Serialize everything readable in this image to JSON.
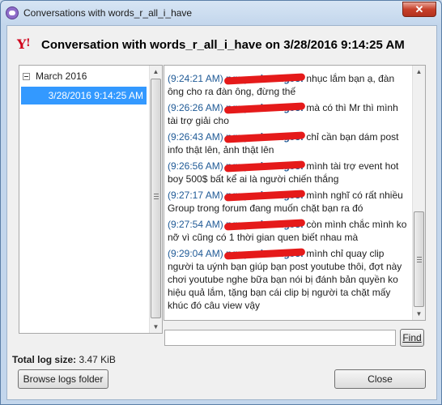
{
  "window": {
    "title": "Conversations with words_r_all_i_have",
    "close_glyph": "✕"
  },
  "header": {
    "title": "Conversation with words_r_all_i_have on 3/28/2016 9:14:25 AM"
  },
  "tree": {
    "group_label": "March 2016",
    "selected_item": "3/28/2016 9:14:25 AM"
  },
  "messages": [
    {
      "time": "(9:24:21 AM)",
      "nick": "nguyenhoang93:",
      "text": " nhục lắm bạn ạ, đàn ông cho ra đàn ông, đừng thế"
    },
    {
      "time": "(9:26:26 AM)",
      "nick": "nguyenhoang93:",
      "text": " mà có thì Mr thì mình tài trợ giải cho"
    },
    {
      "time": "(9:26:43 AM)",
      "nick": "nguyenhoang93:",
      "text": " chỉ cần bạn dám post info thật lên, ảnh thật lên"
    },
    {
      "time": "(9:26:56 AM)",
      "nick": "nguyenhoang93:",
      "text": " mình tài trợ event hot boy 500$ bất kể ai là người chiến thắng"
    },
    {
      "time": "(9:27:17 AM)",
      "nick": "nguyenhoang93:",
      "text": " mình nghĩ có rất nhiều Group trong forum đang muốn chặt bạn ra đó"
    },
    {
      "time": "(9:27:54 AM)",
      "nick": "nguyenhoang93:",
      "text": " còn mình chắc mình ko nỡ vì cũng có 1 thời gian quen biết nhau mà"
    },
    {
      "time": "(9:29:04 AM)",
      "nick": "nguyenhoang93:",
      "text": " mình chỉ quay clip người ta uýnh bạn giúp bạn post youtube thôi, đợt này chơi youtube nghe bữa bạn nói bị đánh bản quyền ko hiệu quả lắm, tặng bạn cái clip bị người ta chặt mấy khúc đó câu view vậy"
    }
  ],
  "search": {
    "value": "",
    "find_label": "Find"
  },
  "footer": {
    "log_size_label": "Total log size:",
    "log_size_value": "3.47 KiB",
    "browse_label": "Browse logs folder",
    "close_label": "Close"
  },
  "colors": {
    "timestamp": "#1f5a96",
    "selection": "#3399ff",
    "redaction": "#e51a1a"
  },
  "icons": {
    "app": "pidgin-icon",
    "logo": "yahoo-icon"
  }
}
